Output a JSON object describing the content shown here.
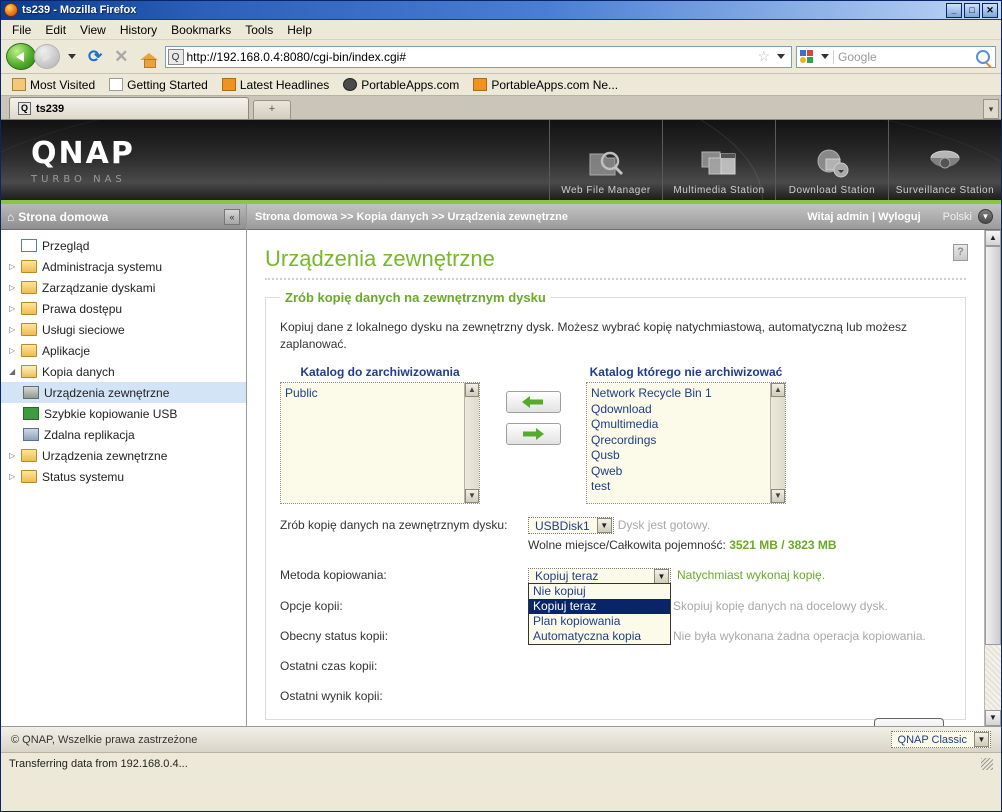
{
  "window": {
    "title": "ts239 - Mozilla Firefox",
    "minimize": "_",
    "maximize": "□",
    "close": "✕"
  },
  "menu": [
    "File",
    "Edit",
    "View",
    "History",
    "Bookmarks",
    "Tools",
    "Help"
  ],
  "nav": {
    "url": "http://192.168.0.4:8080/cgi-bin/index.cgi#",
    "search_placeholder": "Google"
  },
  "bookmarks": [
    {
      "label": "Most Visited",
      "icon": "folder-icon"
    },
    {
      "label": "Getting Started",
      "icon": "page-icon"
    },
    {
      "label": "Latest Headlines",
      "icon": "rss-icon"
    },
    {
      "label": "PortableApps.com",
      "icon": "shield-icon"
    },
    {
      "label": "PortableApps.com Ne...",
      "icon": "rss-icon"
    }
  ],
  "tab": {
    "label": "ts239",
    "newtab": "+",
    "scroll": "▾"
  },
  "banner": {
    "logo": "QNAP",
    "tagline": "TURBO NAS",
    "apps": [
      {
        "label": "Web File Manager",
        "icon": "folder-search-icon"
      },
      {
        "label": "Multimedia Station",
        "icon": "photo-film-icon"
      },
      {
        "label": "Download Station",
        "icon": "download-globe-icon"
      },
      {
        "label": "Surveillance Station",
        "icon": "camera-dome-icon"
      }
    ]
  },
  "sidebar": {
    "header": "Strona domowa",
    "collapse": "«",
    "items": [
      {
        "label": "Przegląd",
        "icon": "overview-icon",
        "arrow": "",
        "level": 0,
        "selected": false
      },
      {
        "label": "Administracja systemu",
        "icon": "folder-icon",
        "arrow": "▷",
        "level": 0,
        "selected": false
      },
      {
        "label": "Zarządzanie dyskami",
        "icon": "folder-icon",
        "arrow": "▷",
        "level": 0,
        "selected": false
      },
      {
        "label": "Prawa dostępu",
        "icon": "folder-icon",
        "arrow": "▷",
        "level": 0,
        "selected": false
      },
      {
        "label": "Usługi sieciowe",
        "icon": "folder-icon",
        "arrow": "▷",
        "level": 0,
        "selected": false
      },
      {
        "label": "Aplikacje",
        "icon": "folder-icon",
        "arrow": "▷",
        "level": 0,
        "selected": false
      },
      {
        "label": "Kopia danych",
        "icon": "folder-open-icon",
        "arrow": "◢",
        "level": 0,
        "selected": false
      },
      {
        "label": "Urządzenia zewnętrzne",
        "icon": "device-icon",
        "arrow": "",
        "level": 1,
        "selected": true
      },
      {
        "label": "Szybkie kopiowanie USB",
        "icon": "usb-icon",
        "arrow": "",
        "level": 1,
        "selected": false
      },
      {
        "label": "Zdalna replikacja",
        "icon": "replication-icon",
        "arrow": "",
        "level": 1,
        "selected": false
      },
      {
        "label": "Urządzenia zewnętrzne",
        "icon": "folder-icon",
        "arrow": "▷",
        "level": 0,
        "selected": false
      },
      {
        "label": "Status systemu",
        "icon": "folder-icon",
        "arrow": "▷",
        "level": 0,
        "selected": false
      }
    ]
  },
  "breadcrumb": {
    "path": "Strona domowa >> Kopia danych >> Urządzenia zewnętrzne",
    "welcome": "Witaj admin | Wyloguj",
    "language": "Polski"
  },
  "page": {
    "title": "Urządzenia zewnętrzne",
    "help": "?",
    "legend": "Zrób kopię danych na zewnętrznym dysku",
    "description": "Kopiuj dane z lokalnego dysku na zewnętrzny dysk. Możesz wybrać kopię natychmiastową, automatyczną lub możesz zaplanować.",
    "left_list_label": "Katalog do zarchiwizowania",
    "right_list_label": "Katalog którego nie archiwizować",
    "left_list_items": [
      "Public"
    ],
    "right_list_items": [
      "Network Recycle Bin 1",
      "Qdownload",
      "Qmultimedia",
      "Qrecordings",
      "Qusb",
      "Qweb",
      "test"
    ],
    "move_left": "←",
    "move_right": "→",
    "rows": [
      {
        "label": "Zrób kopię danych na zewnętrznym dysku:",
        "select_value": "USBDisk1",
        "note": "Dysk  jest gotowy.",
        "note_style": "muted"
      },
      {
        "label": "Metoda kopiowania:",
        "select_value": "Kopiuj teraz",
        "note": "Natychmiast wykonaj kopię.",
        "note_style": "green"
      },
      {
        "label": "Opcje kopii:",
        "note": "Skopiuj kopię danych na docelowy dysk.",
        "note_style": "muted"
      },
      {
        "label": "Obecny status kopii:",
        "note": "Nie była wykonana żadna operacja kopiowania.",
        "note_style": "muted"
      },
      {
        "label": "Ostatni czas kopii:",
        "note": ""
      },
      {
        "label": "Ostatni wynik kopii:",
        "note": ""
      }
    ],
    "capacity_label": "Wolne miejsce/Całkowita pojemność:",
    "capacity_value": "3521 MB / 3823 MB",
    "method_options": [
      {
        "label": "Nie kopiuj",
        "selected": false
      },
      {
        "label": "Kopiuj teraz",
        "selected": true
      },
      {
        "label": "Plan kopiowania",
        "selected": false
      },
      {
        "label": "Automatyczna kopia",
        "selected": false
      }
    ]
  },
  "footer": {
    "copyright": "© QNAP, Wszelkie prawa zastrzeżone",
    "theme": "QNAP Classic"
  },
  "status": {
    "text": "Transferring data from 192.168.0.4..."
  },
  "colors": {
    "accent_green": "#76b82a",
    "link_blue": "#1f3d8c",
    "title_blue": "#0a3b8c",
    "select_highlight": "#0a246a"
  }
}
